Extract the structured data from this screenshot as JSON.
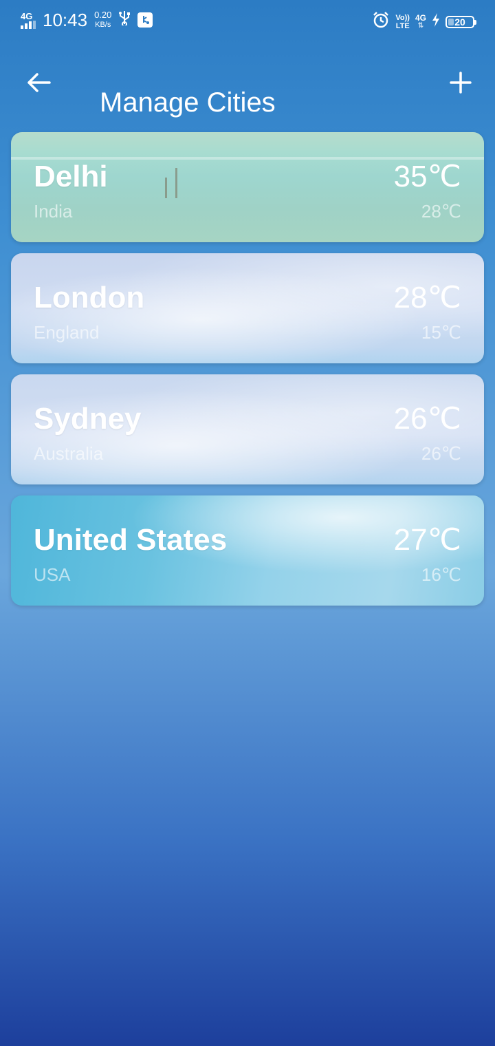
{
  "status_bar": {
    "network": "4G",
    "time": "10:43",
    "speed_value": "0.20",
    "speed_unit": "KB/s",
    "volte_top": "Vo))",
    "volte_bottom": "LTE",
    "network_right": "4G",
    "battery": "20",
    "icons": [
      "signal-icon",
      "usb-icon",
      "usb-debug-icon",
      "alarm-icon",
      "volte-icon",
      "network-4g-icon",
      "charging-icon",
      "battery-icon"
    ]
  },
  "header": {
    "title": "Manage Cities",
    "back_icon": "arrow-left-icon",
    "add_icon": "plus-icon"
  },
  "cities": [
    {
      "name": "Delhi",
      "country": "India",
      "temp_high": "35℃",
      "temp_low": "28℃"
    },
    {
      "name": "London",
      "country": "England",
      "temp_high": "28℃",
      "temp_low": "15℃"
    },
    {
      "name": "Sydney",
      "country": "Australia",
      "temp_high": "26℃",
      "temp_low": "26℃"
    },
    {
      "name": "United States",
      "country": "USA",
      "temp_high": "27℃",
      "temp_low": "16℃"
    }
  ],
  "colors": {
    "background_top": "#2c7cc4",
    "background_bottom": "#1d3f9c",
    "text": "#ffffff"
  }
}
